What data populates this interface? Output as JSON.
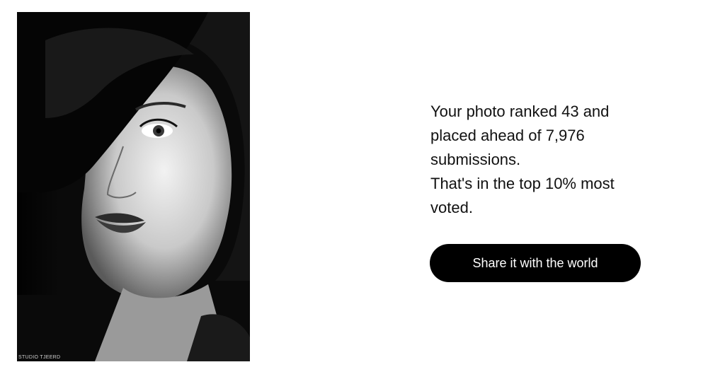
{
  "photo": {
    "watermark": "STUDIO TJEERD",
    "icon": "portrait-photo"
  },
  "result": {
    "line1": "Your photo ranked 43 and placed ahead of 7,976 submissions.",
    "line2": "That's in the top 10% most voted."
  },
  "share": {
    "label": "Share it with the world"
  },
  "colors": {
    "button_bg": "#000000",
    "button_text": "#ffffff",
    "text": "#111111"
  }
}
